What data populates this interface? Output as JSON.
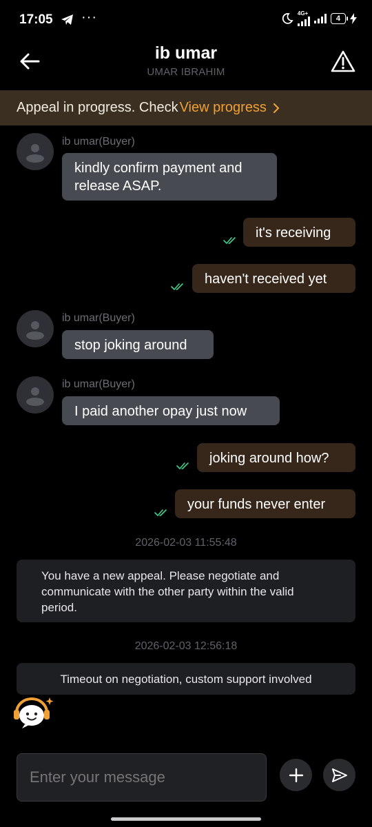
{
  "status_bar": {
    "time": "17:05",
    "network": "4G+",
    "battery": "4"
  },
  "header": {
    "title": "ib umar",
    "subtitle": "UMAR IBRAHIM"
  },
  "banner": {
    "text": "Appeal in progress. Check",
    "link": "View progress"
  },
  "messages": {
    "m1": {
      "sender": "ib umar(Buyer)",
      "line1": "kindly confirm payment and",
      "line2": "release ASAP."
    },
    "m2": {
      "text": "it's receiving"
    },
    "m3": {
      "text": "haven't received yet"
    },
    "m4": {
      "sender": "ib umar(Buyer)",
      "text": "stop joking around"
    },
    "m5": {
      "sender": "ib umar(Buyer)",
      "text": "I paid another opay just now"
    },
    "m6": {
      "text": "joking around how?"
    },
    "m7": {
      "text": "your funds never enter"
    }
  },
  "system": {
    "ts1": "2026-02-03 11:55:48",
    "notice1_line1": "You have a new appeal. Please negotiate and",
    "notice1_line2": "communicate with the other party within the valid",
    "notice1_line3": "period.",
    "ts2": "2026-02-03 12:56:18",
    "notice2": "Timeout on negotiation, custom support involved"
  },
  "composer": {
    "placeholder": "Enter your message"
  },
  "colors": {
    "accent": "#f0a035",
    "outgoing_bubble": "#36271a",
    "incoming_bubble": "#474a51",
    "banner_bg": "#3a2f20",
    "read_tick": "#3ecf8e"
  }
}
